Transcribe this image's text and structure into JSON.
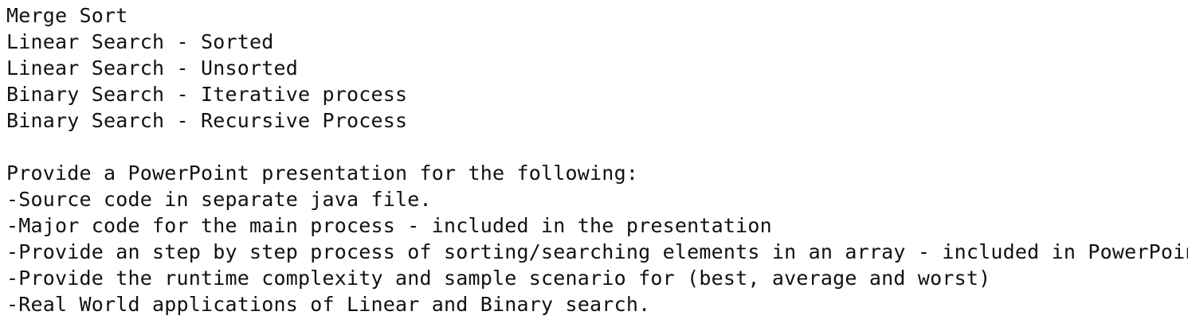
{
  "document": {
    "lines": [
      "Merge Sort",
      "Linear Search - Sorted",
      "Linear Search - Unsorted",
      "Binary Search - Iterative process",
      "Binary Search - Recursive Process",
      "",
      "Provide a PowerPoint presentation for the following:",
      "-Source code in separate java file.",
      "-Major code for the main process - included in the presentation",
      "-Provide an step by step process of sorting/searching elements in an array - included in PowerPoint",
      "-Provide the runtime complexity and sample scenario for (best, average and worst)",
      "-Real World applications of Linear and Binary search."
    ]
  }
}
